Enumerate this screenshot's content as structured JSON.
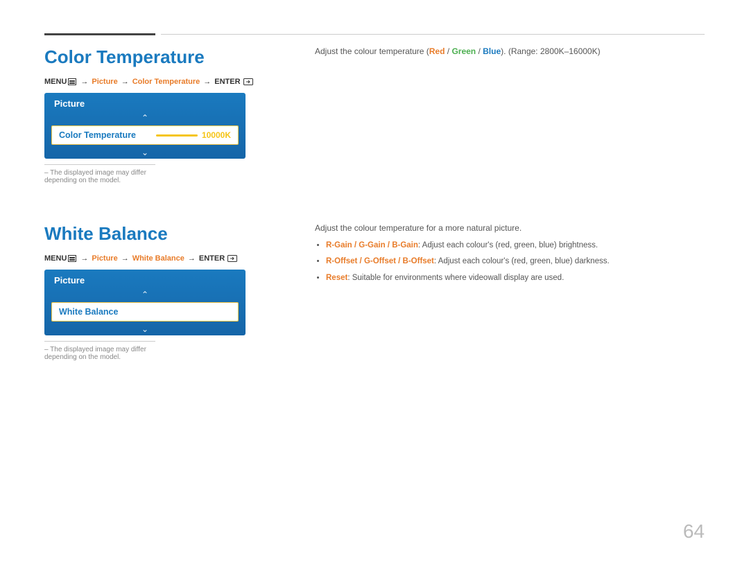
{
  "page": {
    "number": "64"
  },
  "sections": [
    {
      "id": "color-temperature",
      "title": "Color Temperature",
      "menu_path": {
        "base": "MENU",
        "arrow1": "→",
        "item1": "Picture",
        "arrow2": "→",
        "item2": "Color Temperature",
        "arrow3": "→",
        "item3": "ENTER"
      },
      "tv_menu": {
        "header": "Picture",
        "selected_item": "Color Temperature",
        "selected_value": "10000K"
      },
      "disclaimer": "The displayed image may differ depending on the model.",
      "right": {
        "description": "Adjust the colour temperature (Red / Green / Blue). (Range: 2800K–16000K)",
        "bullets": []
      }
    },
    {
      "id": "white-balance",
      "title": "White Balance",
      "menu_path": {
        "base": "MENU",
        "arrow1": "→",
        "item1": "Picture",
        "arrow2": "→",
        "item2": "White Balance",
        "arrow3": "→",
        "item3": "ENTER"
      },
      "tv_menu": {
        "header": "Picture",
        "selected_item": "White Balance",
        "selected_value": ""
      },
      "disclaimer": "The displayed image may differ depending on the model.",
      "right": {
        "description": "Adjust the colour temperature for a more natural picture.",
        "bullets": [
          {
            "terms": [
              "R-Gain",
              "G-Gain",
              "B-Gain"
            ],
            "text": ": Adjust each colour's (red, green, blue) brightness."
          },
          {
            "terms": [
              "R-Offset",
              "G-Offset",
              "B-Offset"
            ],
            "text": ": Adjust each colour's (red, green, blue) darkness."
          },
          {
            "terms": [
              "Reset"
            ],
            "text": ": Suitable for environments where videowall display are used."
          }
        ]
      }
    }
  ]
}
